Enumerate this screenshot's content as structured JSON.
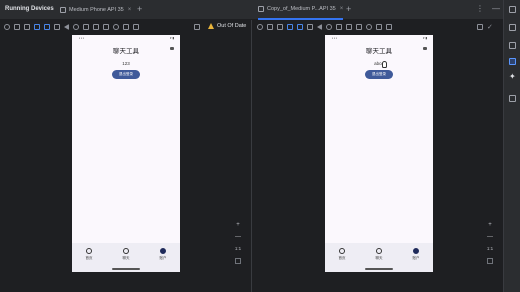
{
  "tool_window": {
    "title": "Running Devices"
  },
  "tabs": [
    {
      "label": "Medium Phone API 35",
      "active": false
    },
    {
      "label": "Copy_of_Medium P...API 35",
      "active": true
    }
  ],
  "status": {
    "out_of_date": "Out Of Date"
  },
  "devices": [
    {
      "app_title": "聊天工具",
      "message": "123",
      "button_label": "退出登录",
      "nav": [
        {
          "label": "首页",
          "icon": "phone-icon"
        },
        {
          "label": "聊天",
          "icon": "chat-icon"
        },
        {
          "label": "账户",
          "icon": "account-icon"
        }
      ],
      "zoom": {
        "plus": "+",
        "minus": "—",
        "ratio": "1:1"
      }
    },
    {
      "app_title": "聊天工具",
      "message": "abcd",
      "button_label": "退出登录",
      "nav": [
        {
          "label": "首页",
          "icon": "phone-icon"
        },
        {
          "label": "聊天",
          "icon": "chat-icon"
        },
        {
          "label": "账户",
          "icon": "account-icon"
        }
      ],
      "zoom": {
        "plus": "+",
        "minus": "—",
        "ratio": "1:1"
      }
    }
  ],
  "colors": {
    "accent": "#3574f0",
    "warning": "#e8b43b",
    "app_button": "#3f5a9a"
  }
}
